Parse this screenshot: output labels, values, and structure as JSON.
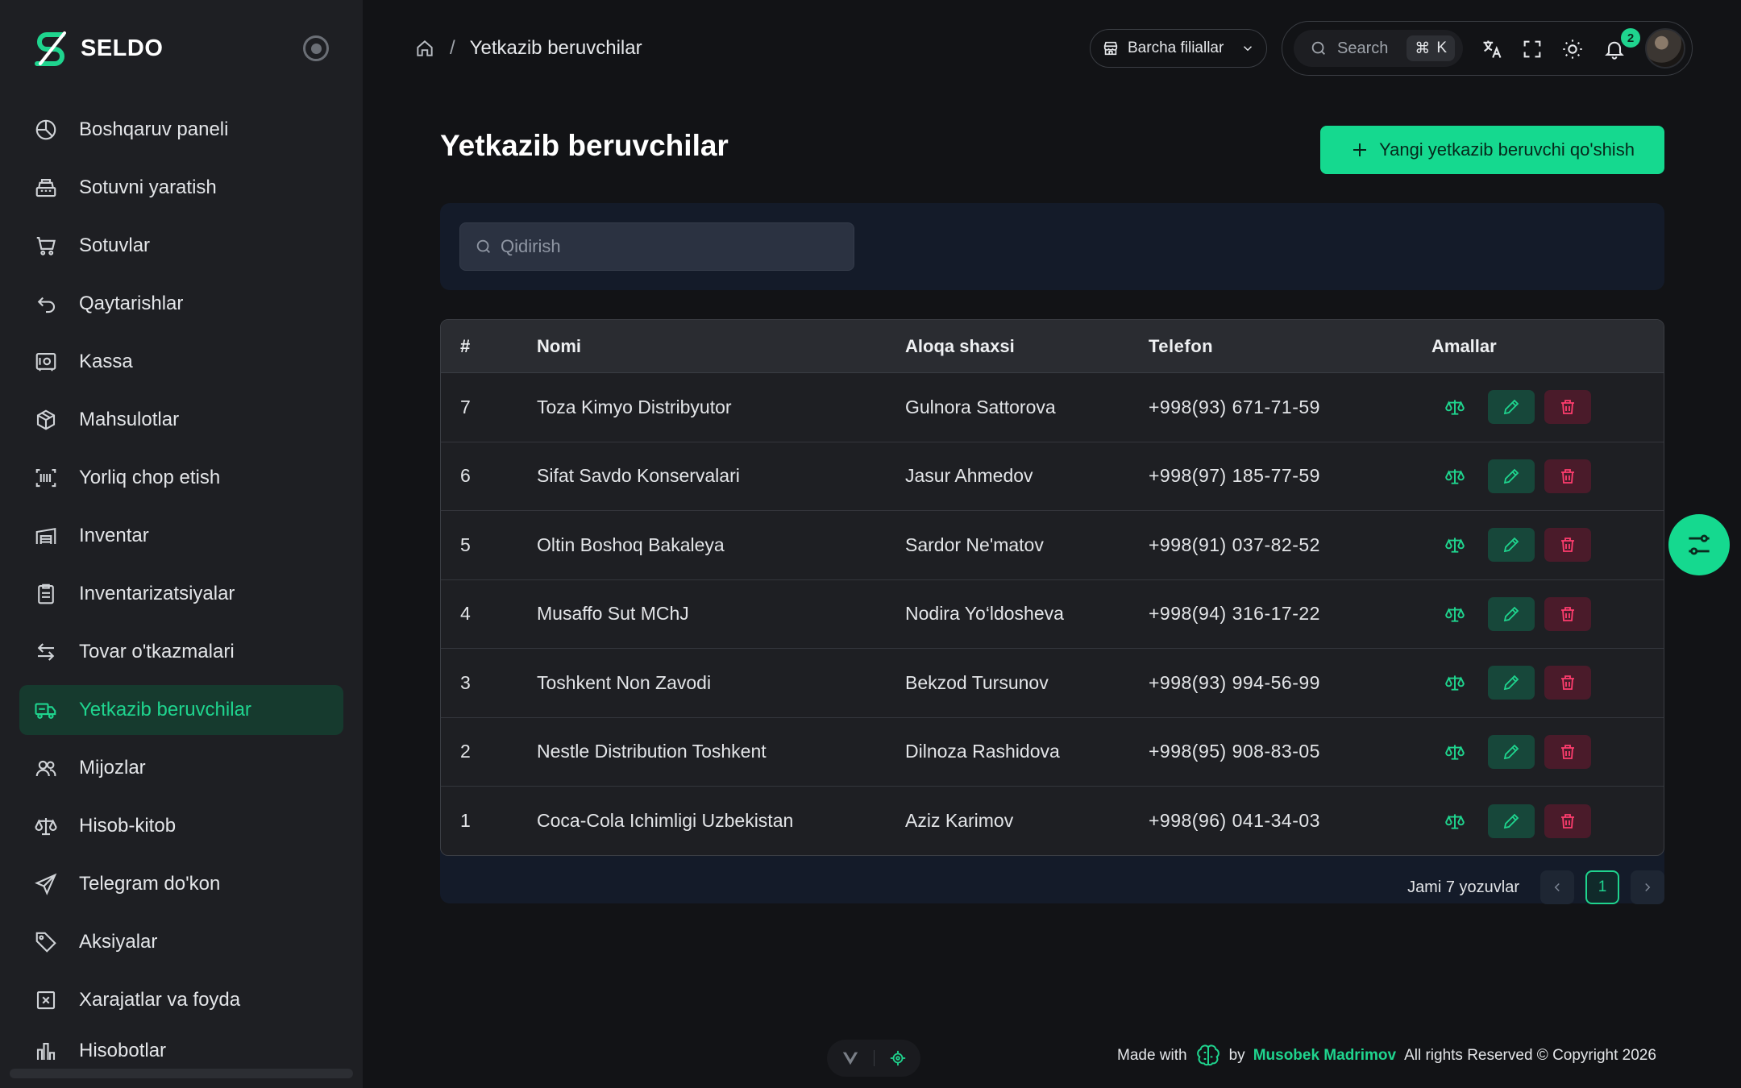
{
  "brand": {
    "name": "SELDO"
  },
  "sidebar": {
    "items": [
      {
        "label": "Boshqaruv paneli",
        "icon": "dashboard-icon"
      },
      {
        "label": "Sotuvni yaratish",
        "icon": "cash-register-icon"
      },
      {
        "label": "Sotuvlar",
        "icon": "cart-icon"
      },
      {
        "label": "Qaytarishlar",
        "icon": "return-icon"
      },
      {
        "label": "Kassa",
        "icon": "safe-icon"
      },
      {
        "label": "Mahsulotlar",
        "icon": "package-icon"
      },
      {
        "label": "Yorliq chop etish",
        "icon": "barcode-icon"
      },
      {
        "label": "Inventar",
        "icon": "warehouse-icon"
      },
      {
        "label": "Inventarizatsiyalar",
        "icon": "clipboard-icon"
      },
      {
        "label": "Tovar o'tkazmalari",
        "icon": "transfer-icon"
      },
      {
        "label": "Yetkazib beruvchilar",
        "icon": "truck-icon",
        "active": true
      },
      {
        "label": "Mijozlar",
        "icon": "users-icon"
      },
      {
        "label": "Hisob-kitob",
        "icon": "scale-icon"
      },
      {
        "label": "Telegram do'kon",
        "icon": "send-icon"
      },
      {
        "label": "Aksiyalar",
        "icon": "tag-icon"
      },
      {
        "label": "Xarajatlar va foyda",
        "icon": "receipt-icon"
      },
      {
        "label": "Hisobotlar",
        "icon": "report-icon"
      }
    ]
  },
  "header": {
    "breadcrumb_current": "Yetkazib beruvchilar",
    "branch_select": "Barcha filiallar",
    "search_label": "Search",
    "search_shortcut_mod": "⌘",
    "search_shortcut_key": "K",
    "notification_count": "2"
  },
  "page": {
    "title": "Yetkazib beruvchilar",
    "add_button": "Yangi yetkazib beruvchi qo'shish",
    "search_placeholder": "Qidirish"
  },
  "table": {
    "columns": {
      "id": "#",
      "name": "Nomi",
      "contact": "Aloqa shaxsi",
      "phone": "Telefon",
      "actions": "Amallar"
    },
    "rows": [
      {
        "id": "7",
        "name": "Toza Kimyo Distribyutor",
        "contact": "Gulnora Sattorova",
        "phone": "+998(93) 671-71-59"
      },
      {
        "id": "6",
        "name": "Sifat Savdo Konservalari",
        "contact": "Jasur Ahmedov",
        "phone": "+998(97) 185-77-59"
      },
      {
        "id": "5",
        "name": "Oltin Boshoq Bakaleya",
        "contact": "Sardor Ne'matov",
        "phone": "+998(91) 037-82-52"
      },
      {
        "id": "4",
        "name": "Musaffo Sut MChJ",
        "contact": "Nodira Yo‘ldosheva",
        "phone": "+998(94) 316-17-22"
      },
      {
        "id": "3",
        "name": "Toshkent Non Zavodi",
        "contact": "Bekzod Tursunov",
        "phone": "+998(93) 994-56-99"
      },
      {
        "id": "2",
        "name": "Nestle Distribution Toshkent",
        "contact": "Dilnoza Rashidova",
        "phone": "+998(95) 908-83-05"
      },
      {
        "id": "1",
        "name": "Coca-Cola Ichimligi Uzbekistan",
        "contact": "Aziz Karimov",
        "phone": "+998(96) 041-34-03"
      }
    ]
  },
  "pagination": {
    "total_text": "Jami 7 yozuvlar",
    "current_page": "1"
  },
  "footer": {
    "made_with": "Made with",
    "by": "by",
    "author": "Musobek Madrimov",
    "rights": "All rights Reserved © Copyright 2026"
  },
  "colors": {
    "accent": "#1fd48e",
    "danger": "#ff3d6e",
    "background": "#121316",
    "sidebar": "#1e1f23"
  }
}
